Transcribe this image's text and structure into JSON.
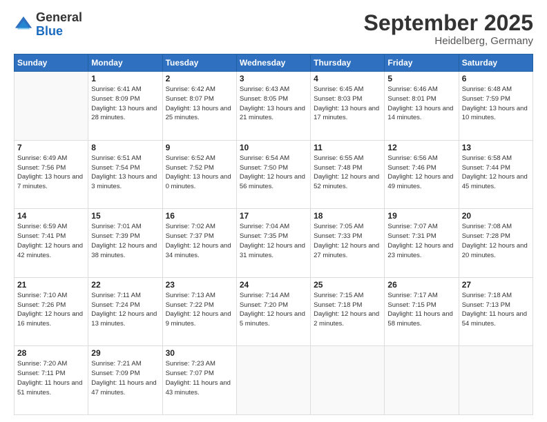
{
  "logo": {
    "general": "General",
    "blue": "Blue"
  },
  "title": {
    "month": "September 2025",
    "location": "Heidelberg, Germany"
  },
  "days_of_week": [
    "Sunday",
    "Monday",
    "Tuesday",
    "Wednesday",
    "Thursday",
    "Friday",
    "Saturday"
  ],
  "weeks": [
    [
      {
        "day": "",
        "sunrise": "",
        "sunset": "",
        "daylight": ""
      },
      {
        "day": "1",
        "sunrise": "Sunrise: 6:41 AM",
        "sunset": "Sunset: 8:09 PM",
        "daylight": "Daylight: 13 hours and 28 minutes."
      },
      {
        "day": "2",
        "sunrise": "Sunrise: 6:42 AM",
        "sunset": "Sunset: 8:07 PM",
        "daylight": "Daylight: 13 hours and 25 minutes."
      },
      {
        "day": "3",
        "sunrise": "Sunrise: 6:43 AM",
        "sunset": "Sunset: 8:05 PM",
        "daylight": "Daylight: 13 hours and 21 minutes."
      },
      {
        "day": "4",
        "sunrise": "Sunrise: 6:45 AM",
        "sunset": "Sunset: 8:03 PM",
        "daylight": "Daylight: 13 hours and 17 minutes."
      },
      {
        "day": "5",
        "sunrise": "Sunrise: 6:46 AM",
        "sunset": "Sunset: 8:01 PM",
        "daylight": "Daylight: 13 hours and 14 minutes."
      },
      {
        "day": "6",
        "sunrise": "Sunrise: 6:48 AM",
        "sunset": "Sunset: 7:59 PM",
        "daylight": "Daylight: 13 hours and 10 minutes."
      }
    ],
    [
      {
        "day": "7",
        "sunrise": "Sunrise: 6:49 AM",
        "sunset": "Sunset: 7:56 PM",
        "daylight": "Daylight: 13 hours and 7 minutes."
      },
      {
        "day": "8",
        "sunrise": "Sunrise: 6:51 AM",
        "sunset": "Sunset: 7:54 PM",
        "daylight": "Daylight: 13 hours and 3 minutes."
      },
      {
        "day": "9",
        "sunrise": "Sunrise: 6:52 AM",
        "sunset": "Sunset: 7:52 PM",
        "daylight": "Daylight: 13 hours and 0 minutes."
      },
      {
        "day": "10",
        "sunrise": "Sunrise: 6:54 AM",
        "sunset": "Sunset: 7:50 PM",
        "daylight": "Daylight: 12 hours and 56 minutes."
      },
      {
        "day": "11",
        "sunrise": "Sunrise: 6:55 AM",
        "sunset": "Sunset: 7:48 PM",
        "daylight": "Daylight: 12 hours and 52 minutes."
      },
      {
        "day": "12",
        "sunrise": "Sunrise: 6:56 AM",
        "sunset": "Sunset: 7:46 PM",
        "daylight": "Daylight: 12 hours and 49 minutes."
      },
      {
        "day": "13",
        "sunrise": "Sunrise: 6:58 AM",
        "sunset": "Sunset: 7:44 PM",
        "daylight": "Daylight: 12 hours and 45 minutes."
      }
    ],
    [
      {
        "day": "14",
        "sunrise": "Sunrise: 6:59 AM",
        "sunset": "Sunset: 7:41 PM",
        "daylight": "Daylight: 12 hours and 42 minutes."
      },
      {
        "day": "15",
        "sunrise": "Sunrise: 7:01 AM",
        "sunset": "Sunset: 7:39 PM",
        "daylight": "Daylight: 12 hours and 38 minutes."
      },
      {
        "day": "16",
        "sunrise": "Sunrise: 7:02 AM",
        "sunset": "Sunset: 7:37 PM",
        "daylight": "Daylight: 12 hours and 34 minutes."
      },
      {
        "day": "17",
        "sunrise": "Sunrise: 7:04 AM",
        "sunset": "Sunset: 7:35 PM",
        "daylight": "Daylight: 12 hours and 31 minutes."
      },
      {
        "day": "18",
        "sunrise": "Sunrise: 7:05 AM",
        "sunset": "Sunset: 7:33 PM",
        "daylight": "Daylight: 12 hours and 27 minutes."
      },
      {
        "day": "19",
        "sunrise": "Sunrise: 7:07 AM",
        "sunset": "Sunset: 7:31 PM",
        "daylight": "Daylight: 12 hours and 23 minutes."
      },
      {
        "day": "20",
        "sunrise": "Sunrise: 7:08 AM",
        "sunset": "Sunset: 7:28 PM",
        "daylight": "Daylight: 12 hours and 20 minutes."
      }
    ],
    [
      {
        "day": "21",
        "sunrise": "Sunrise: 7:10 AM",
        "sunset": "Sunset: 7:26 PM",
        "daylight": "Daylight: 12 hours and 16 minutes."
      },
      {
        "day": "22",
        "sunrise": "Sunrise: 7:11 AM",
        "sunset": "Sunset: 7:24 PM",
        "daylight": "Daylight: 12 hours and 13 minutes."
      },
      {
        "day": "23",
        "sunrise": "Sunrise: 7:13 AM",
        "sunset": "Sunset: 7:22 PM",
        "daylight": "Daylight: 12 hours and 9 minutes."
      },
      {
        "day": "24",
        "sunrise": "Sunrise: 7:14 AM",
        "sunset": "Sunset: 7:20 PM",
        "daylight": "Daylight: 12 hours and 5 minutes."
      },
      {
        "day": "25",
        "sunrise": "Sunrise: 7:15 AM",
        "sunset": "Sunset: 7:18 PM",
        "daylight": "Daylight: 12 hours and 2 minutes."
      },
      {
        "day": "26",
        "sunrise": "Sunrise: 7:17 AM",
        "sunset": "Sunset: 7:15 PM",
        "daylight": "Daylight: 11 hours and 58 minutes."
      },
      {
        "day": "27",
        "sunrise": "Sunrise: 7:18 AM",
        "sunset": "Sunset: 7:13 PM",
        "daylight": "Daylight: 11 hours and 54 minutes."
      }
    ],
    [
      {
        "day": "28",
        "sunrise": "Sunrise: 7:20 AM",
        "sunset": "Sunset: 7:11 PM",
        "daylight": "Daylight: 11 hours and 51 minutes."
      },
      {
        "day": "29",
        "sunrise": "Sunrise: 7:21 AM",
        "sunset": "Sunset: 7:09 PM",
        "daylight": "Daylight: 11 hours and 47 minutes."
      },
      {
        "day": "30",
        "sunrise": "Sunrise: 7:23 AM",
        "sunset": "Sunset: 7:07 PM",
        "daylight": "Daylight: 11 hours and 43 minutes."
      },
      {
        "day": "",
        "sunrise": "",
        "sunset": "",
        "daylight": ""
      },
      {
        "day": "",
        "sunrise": "",
        "sunset": "",
        "daylight": ""
      },
      {
        "day": "",
        "sunrise": "",
        "sunset": "",
        "daylight": ""
      },
      {
        "day": "",
        "sunrise": "",
        "sunset": "",
        "daylight": ""
      }
    ]
  ]
}
